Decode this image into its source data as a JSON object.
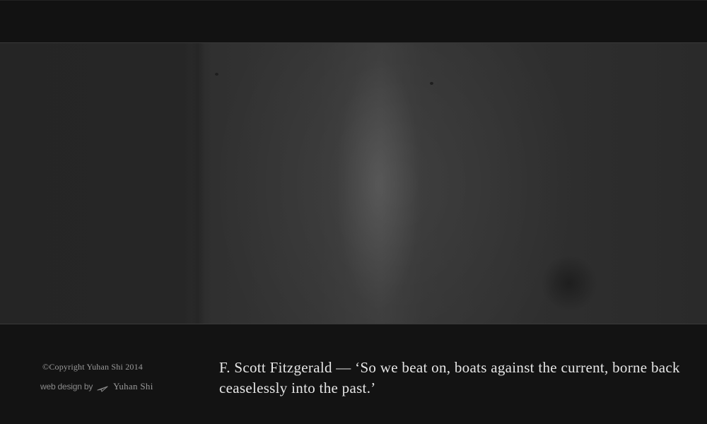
{
  "footer": {
    "copyright": "©Copyright Yuhan Shi 2014",
    "credit_prefix": "web design by",
    "credit_icon": "paper-plane-icon",
    "credit_name": "Yuhan Shi",
    "quote": "F. Scott Fitzgerald — ‘So we beat on, boats against the current, borne back ceaselessly into the past.’"
  },
  "colors": {
    "background": "#131313",
    "hero_light": "#3a3a3a",
    "quote_text": "#e6e6e6",
    "muted_text": "#9a9a9a"
  }
}
